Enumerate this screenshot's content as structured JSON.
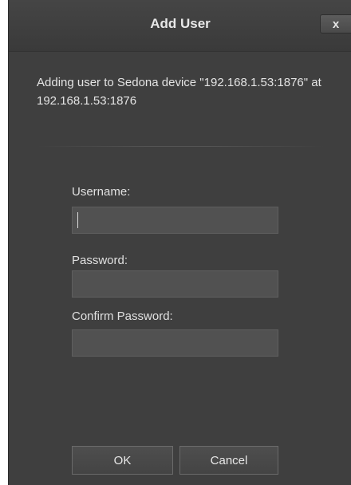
{
  "dialog": {
    "title": "Add User",
    "close_label": "x",
    "message": "Adding user to Sedona device \"192.168.1.53:1876\" at 192.168.1.53:1876"
  },
  "form": {
    "username_label": "Username:",
    "username_value": "",
    "password_label": "Password:",
    "password_value": "",
    "confirm_label": "Confirm Password:",
    "confirm_value": ""
  },
  "buttons": {
    "ok_label": "OK",
    "cancel_label": "Cancel"
  },
  "colors": {
    "background": "#3f3f3f",
    "input_fill": "#515151",
    "text": "#e4e4e4"
  }
}
